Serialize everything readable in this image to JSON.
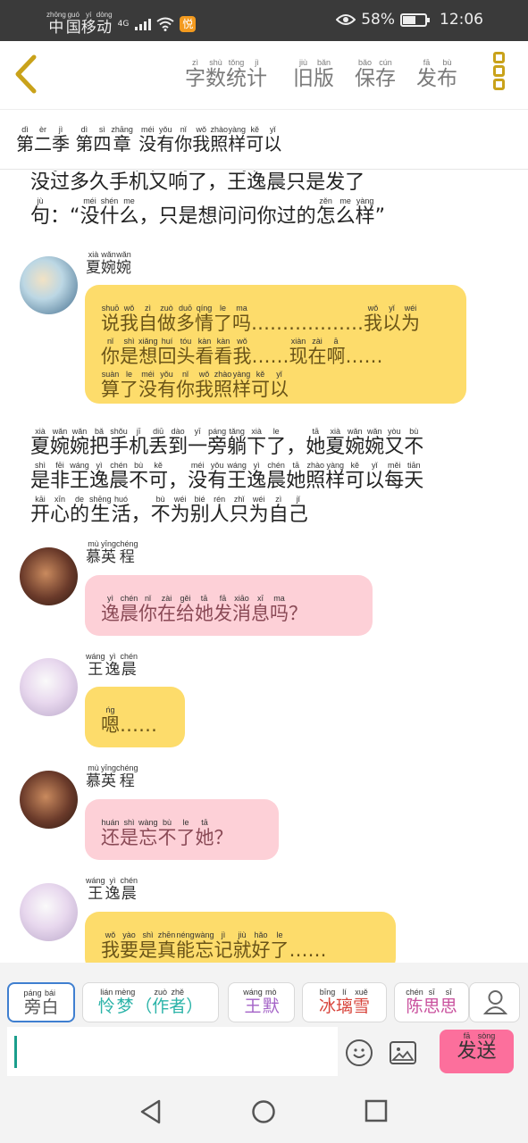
{
  "status_bar": {
    "carrier": "中国移动",
    "carrier_pinyin": [
      "zhōng",
      "guó",
      "yí",
      "dòng"
    ],
    "network": "4G",
    "app_badge": "悦",
    "battery_percent": "58%",
    "battery_level": 0.58,
    "time": "12:06"
  },
  "header": {
    "buttons": [
      {
        "chars": [
          "字",
          "数",
          "统",
          "计"
        ],
        "pinyin": [
          "zì",
          "shù",
          "tǒng",
          "jì"
        ]
      },
      {
        "chars": [
          "旧",
          "版"
        ],
        "pinyin": [
          "jiù",
          "bǎn"
        ]
      },
      {
        "chars": [
          "保",
          "存"
        ],
        "pinyin": [
          "bǎo",
          "cún"
        ]
      },
      {
        "chars": [
          "发",
          "布"
        ],
        "pinyin": [
          "fā",
          "bù"
        ]
      }
    ]
  },
  "chapter": {
    "chars": [
      "第",
      "二",
      "季",
      " ",
      "第",
      "四",
      "章",
      " ",
      "没",
      "有",
      "你",
      "我",
      "照",
      "样",
      "可",
      "以"
    ],
    "pinyin": [
      "dì",
      "èr",
      "jì",
      "",
      "dì",
      "sì",
      "zhāng",
      "",
      "méi",
      "yǒu",
      "nǐ",
      "wǒ",
      "zhào",
      "yàng",
      "kě",
      "yǐ"
    ]
  },
  "content": {
    "narration1": {
      "lines": [
        {
          "chars": [
            "没",
            "过",
            "多",
            "久",
            "手",
            "机",
            "又",
            "响",
            "了",
            "，",
            "王",
            "逸",
            "晨",
            "只",
            "是",
            "发",
            "了"
          ],
          "pinyin": [
            "méi",
            "guò",
            "duō",
            "jiǔ",
            "shǒu",
            "jī",
            "yòu",
            "xiǎng",
            "le",
            "",
            "wáng",
            "yì",
            "chén",
            "zhǐ",
            "shì",
            "fā",
            "le"
          ]
        },
        {
          "chars": [
            "句",
            "：",
            "“",
            "没",
            "什",
            "么",
            "，",
            "只",
            "是",
            "想",
            "问",
            "问",
            "你",
            "过",
            "的",
            "怎",
            "么",
            "样",
            "”"
          ],
          "pinyin": [
            "jù",
            "",
            "",
            "méi",
            "shén",
            "me",
            "",
            "",
            "",
            "",
            "",
            "",
            "",
            "",
            "",
            "zěn",
            "me",
            "yàng",
            ""
          ]
        }
      ]
    },
    "msg1": {
      "speaker": "夏婉婉",
      "speaker_pinyin": [
        "xià",
        "wǎn",
        "wǎn"
      ],
      "lines": [
        {
          "chars": [
            "说",
            "我",
            "自",
            "做",
            "多",
            "情",
            "了",
            "吗",
            "…",
            "…",
            "…",
            "…",
            "…",
            "…",
            "我",
            "以",
            "为"
          ],
          "pinyin": [
            "shuō",
            "wǒ",
            "zì",
            "zuò",
            "duō",
            "qíng",
            "le",
            "ma",
            "",
            "",
            "",
            "",
            "",
            "",
            "wǒ",
            "yǐ",
            "wéi"
          ]
        },
        {
          "chars": [
            "你",
            "是",
            "想",
            "回",
            "头",
            "看",
            "看",
            "我",
            "…",
            "…",
            "现",
            "在",
            "啊",
            "…",
            "…"
          ],
          "pinyin": [
            "nǐ",
            "shì",
            "xiǎng",
            "huí",
            "tóu",
            "kàn",
            "kàn",
            "wǒ",
            "",
            "",
            "xiàn",
            "zài",
            "ā",
            "",
            ""
          ]
        },
        {
          "chars": [
            "算",
            "了",
            "没",
            "有",
            "你",
            "我",
            "照",
            "样",
            "可",
            "以"
          ],
          "pinyin": [
            "suàn",
            "le",
            "méi",
            "yǒu",
            "nǐ",
            "wǒ",
            "zhào",
            "yàng",
            "kě",
            "yǐ"
          ]
        }
      ]
    },
    "narration2": {
      "lines": [
        {
          "chars": [
            "夏",
            "婉",
            "婉",
            "把",
            "手",
            "机",
            "丢",
            "到",
            "一",
            "旁",
            "躺",
            "下",
            "了",
            "，",
            "她",
            "夏",
            "婉",
            "婉",
            "又",
            "不"
          ],
          "pinyin": [
            "xià",
            "wǎn",
            "wǎn",
            "bǎ",
            "shǒu",
            "jī",
            "diū",
            "dào",
            "yī",
            "páng",
            "tǎng",
            "xià",
            "le",
            "",
            "tā",
            "xià",
            "wǎn",
            "wǎn",
            "yòu",
            "bù"
          ]
        },
        {
          "chars": [
            "是",
            "非",
            "王",
            "逸",
            "晨",
            "不",
            "可",
            "，",
            "没",
            "有",
            "王",
            "逸",
            "晨",
            "她",
            "照",
            "样",
            "可",
            "以",
            "每",
            "天"
          ],
          "pinyin": [
            "shì",
            "fēi",
            "wáng",
            "yì",
            "chén",
            "bù",
            "kě",
            "",
            "méi",
            "yǒu",
            "wáng",
            "yì",
            "chén",
            "tā",
            "zhào",
            "yàng",
            "kě",
            "yǐ",
            "měi",
            "tiān"
          ]
        },
        {
          "chars": [
            "开",
            "心",
            "的",
            "生",
            "活",
            "，",
            "不",
            "为",
            "别",
            "人",
            "只",
            "为",
            "自",
            "己"
          ],
          "pinyin": [
            "kāi",
            "xīn",
            "de",
            "shēng",
            "huó",
            "",
            "bù",
            "wéi",
            "bié",
            "rén",
            "zhǐ",
            "wéi",
            "zì",
            "jǐ"
          ]
        }
      ]
    },
    "msg2": {
      "speaker": "慕英程",
      "speaker_pinyin": [
        "mù",
        "yīng",
        "chéng"
      ],
      "lines": [
        {
          "chars": [
            "逸",
            "晨",
            "你",
            "在",
            "给",
            "她",
            "发",
            "消",
            "息",
            "吗",
            "？"
          ],
          "pinyin": [
            "yì",
            "chén",
            "nǐ",
            "zài",
            "gěi",
            "tā",
            "fā",
            "xiāo",
            "xī",
            "ma",
            ""
          ]
        }
      ]
    },
    "msg3": {
      "speaker": "王逸晨",
      "speaker_pinyin": [
        "wáng",
        "yì",
        "chén"
      ],
      "lines": [
        {
          "chars": [
            "嗯",
            "…",
            "…"
          ],
          "pinyin": [
            "ńg",
            "",
            ""
          ]
        }
      ]
    },
    "msg4": {
      "speaker": "慕英程",
      "speaker_pinyin": [
        "mù",
        "yīng",
        "chéng"
      ],
      "lines": [
        {
          "chars": [
            "还",
            "是",
            "忘",
            "不",
            "了",
            "她",
            "？"
          ],
          "pinyin": [
            "huán",
            "shì",
            "wàng",
            "bù",
            "le",
            "tā",
            ""
          ]
        }
      ]
    },
    "msg5": {
      "speaker": "王逸晨",
      "speaker_pinyin": [
        "wáng",
        "yì",
        "chén"
      ],
      "lines": [
        {
          "chars": [
            "我",
            "要",
            "是",
            "真",
            "能",
            "忘",
            "记",
            "就",
            "好",
            "了",
            "…",
            "…"
          ],
          "pinyin": [
            "wǒ",
            "yào",
            "shì",
            "zhēn",
            "néng",
            "wàng",
            "jì",
            "jiù",
            "hǎo",
            "le",
            "",
            ""
          ]
        }
      ]
    }
  },
  "role_bar": {
    "chips": [
      {
        "chars": [
          "旁",
          "白"
        ],
        "pinyin": [
          "páng",
          "bái"
        ],
        "color": "#555555"
      },
      {
        "chars": [
          "怜",
          "梦",
          "（",
          "作",
          "者",
          "）"
        ],
        "pinyin": [
          "lián",
          "mèng",
          "",
          "zuò",
          "zhě",
          ""
        ],
        "color": "#2bb3a8"
      },
      {
        "chars": [
          "王",
          "默"
        ],
        "pinyin": [
          "wáng",
          "mò"
        ],
        "color": "#a463c7"
      },
      {
        "chars": [
          "冰",
          "璃",
          "雪"
        ],
        "pinyin": [
          "bīng",
          "lí",
          "xuě"
        ],
        "color": "#d8453c"
      },
      {
        "chars": [
          "陈",
          "思",
          "思"
        ],
        "pinyin": [
          "chén",
          "sī",
          "sī"
        ],
        "color": "#c9509d"
      }
    ],
    "send": {
      "chars": [
        "发",
        "送"
      ],
      "pinyin": [
        "fā",
        "sòng"
      ]
    }
  },
  "icons": {
    "back": "chevron-left-icon",
    "menu": "more-icon",
    "person": "person-icon",
    "emoji": "emoji-icon",
    "image": "image-icon",
    "nav_back": "nav-back-icon",
    "nav_home": "nav-home-icon",
    "nav_recent": "nav-recent-icon"
  }
}
